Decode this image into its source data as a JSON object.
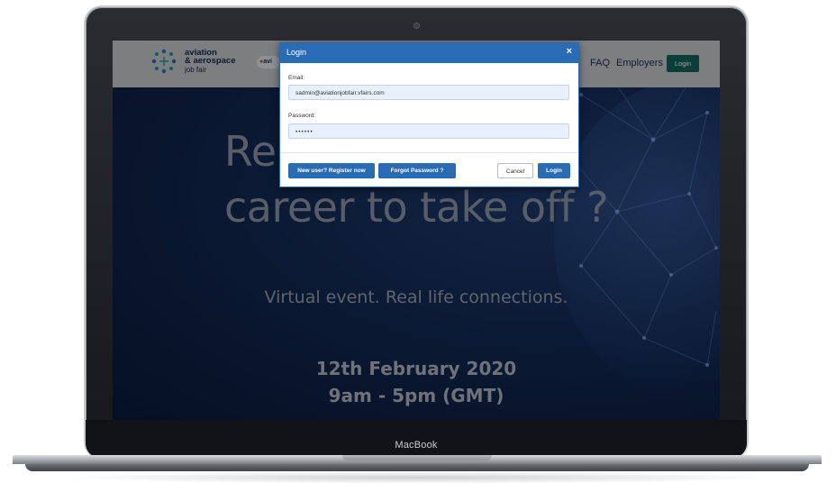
{
  "device": {
    "brand": "MacBook"
  },
  "site": {
    "logo": {
      "line1": "aviation",
      "line2": "& aerospace",
      "line3": "job fair"
    },
    "partner_logo_text": "avi",
    "nav": {
      "faq": "FAQ",
      "employers": "Employers",
      "login": "Login"
    }
  },
  "hero": {
    "line1": "Re",
    "line2": "career to take off ?",
    "subtitle": "Virtual event. Real life connections.",
    "date": "12th February 2020",
    "time": "9am - 5pm (GMT)"
  },
  "login_modal": {
    "title": "Login",
    "close_glyph": "×",
    "email_label": "Email:",
    "email_value": "sadmin@aviationjobfair.vfairs.com",
    "password_label": "Password:",
    "password_value": "••••••",
    "register_button": "New user? Register now",
    "forgot_button": "Forgot Password ?",
    "cancel_button": "Cancel",
    "login_button": "Login"
  },
  "colors": {
    "modal_accent": "#2a6cb4",
    "nav_login_bg": "#13645c",
    "hero_bg": "#132a55"
  }
}
